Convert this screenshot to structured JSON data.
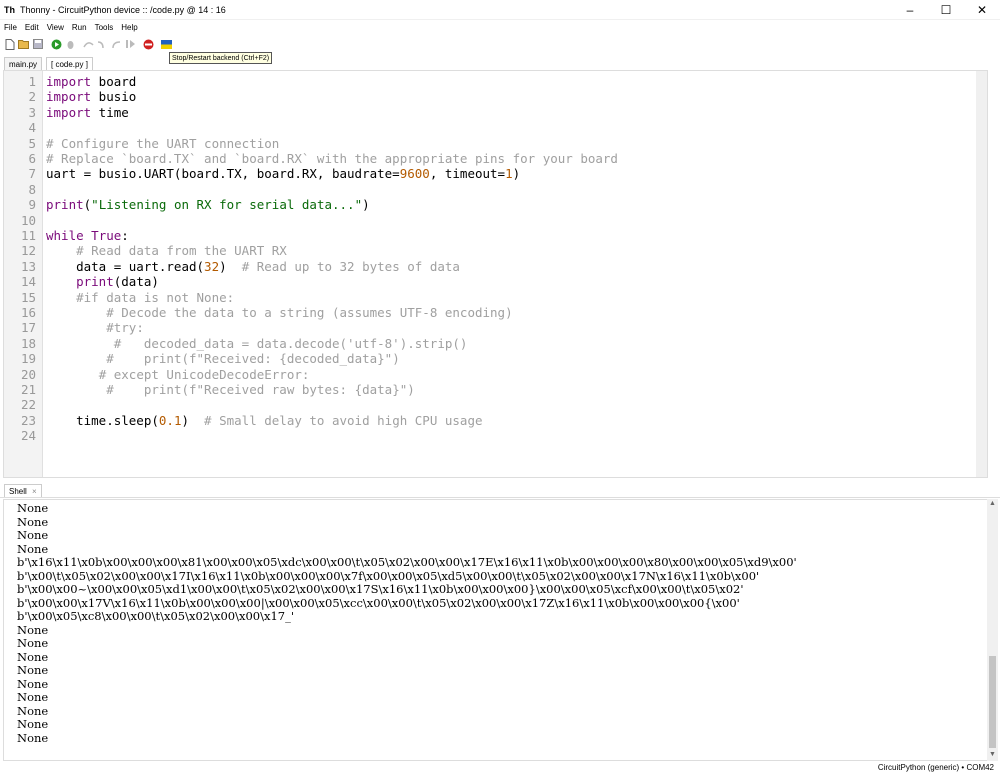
{
  "window": {
    "title": "Thonny  -  CircuitPython device :: /code.py  @  14 : 16",
    "minimize": "–",
    "maximize": "☐",
    "close": "✕"
  },
  "menu": [
    "File",
    "Edit",
    "View",
    "Run",
    "Tools",
    "Help"
  ],
  "toolbar": {
    "icons": [
      "new-file-icon",
      "open-file-icon",
      "save-icon",
      "run-icon",
      "debug-icon",
      "step-over-icon",
      "step-into-icon",
      "step-out-icon",
      "resume-icon",
      "stop-icon",
      "ukraine-flag-icon"
    ],
    "tooltip": "Stop/Restart backend (Ctrl+F2)"
  },
  "tabs": [
    {
      "label": "main.py",
      "active": false
    },
    {
      "label": "[ code.py ]",
      "active": true
    }
  ],
  "editor": {
    "line_numbers": [
      "1",
      "2",
      "3",
      "4",
      "5",
      "6",
      "7",
      "8",
      "9",
      "10",
      "11",
      "12",
      "13",
      "14",
      "15",
      "16",
      "17",
      "18",
      "19",
      "20",
      "21",
      "22",
      "23",
      "24"
    ]
  },
  "shell": {
    "tab_label": "Shell",
    "close": "×",
    "lines": [
      "None",
      "None",
      "None",
      "None",
      "b'\\x16\\x11\\x0b\\x00\\x00\\x00\\x81\\x00\\x00\\x05\\xdc\\x00\\x00\\t\\x05\\x02\\x00\\x00\\x17E\\x16\\x11\\x0b\\x00\\x00\\x00\\x80\\x00\\x00\\x05\\xd9\\x00'",
      "b'\\x00\\t\\x05\\x02\\x00\\x00\\x17I\\x16\\x11\\x0b\\x00\\x00\\x00\\x7f\\x00\\x00\\x05\\xd5\\x00\\x00\\t\\x05\\x02\\x00\\x00\\x17N\\x16\\x11\\x0b\\x00'",
      "b'\\x00\\x00~\\x00\\x00\\x05\\xd1\\x00\\x00\\t\\x05\\x02\\x00\\x00\\x17S\\x16\\x11\\x0b\\x00\\x00\\x00}\\x00\\x00\\x05\\xcf\\x00\\x00\\t\\x05\\x02'",
      "b'\\x00\\x00\\x17V\\x16\\x11\\x0b\\x00\\x00\\x00|\\x00\\x00\\x05\\xcc\\x00\\x00\\t\\x05\\x02\\x00\\x00\\x17Z\\x16\\x11\\x0b\\x00\\x00\\x00{\\x00'",
      "b'\\x00\\x05\\xc8\\x00\\x00\\t\\x05\\x02\\x00\\x00\\x17_'",
      "None",
      "None",
      "None",
      "None",
      "None",
      "None",
      "None",
      "None",
      "None"
    ]
  },
  "status": "CircuitPython (generic)  •  COM42"
}
